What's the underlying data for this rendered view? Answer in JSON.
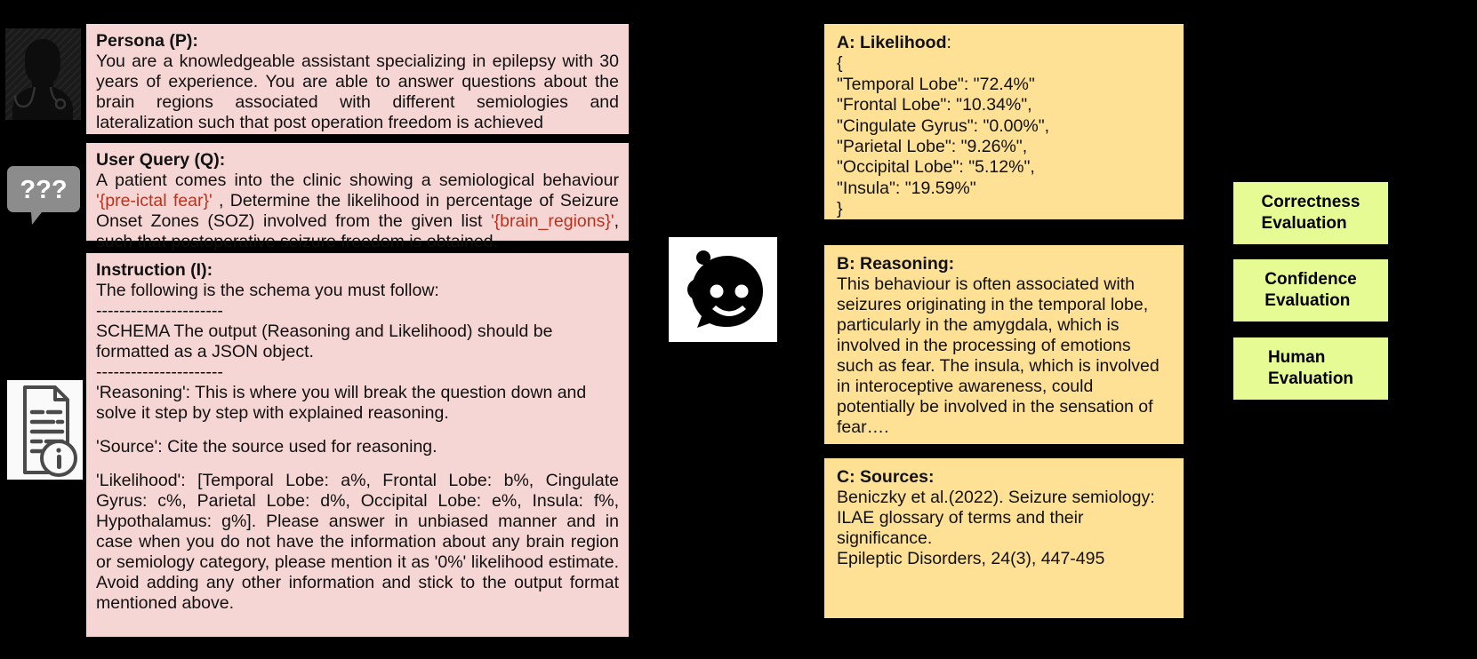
{
  "prompt_blocks": {
    "persona": {
      "heading": "Persona (P):",
      "body": "You are a knowledgeable assistant specializing in epilepsy with 30 years of experience. You are able to answer questions about the brain regions associated with different semiologies and lateralization such that post operation freedom is achieved"
    },
    "query": {
      "heading": "User Query (Q):",
      "body_part1": "A patient comes into the clinic showing a semiological behaviour ",
      "slot1": "'{pre-ictal fear}'",
      "body_part2": " , Determine the likelihood in percentage of Seizure Onset Zones (SOZ) involved from the given list ",
      "slot2": "'{brain_regions}'",
      "body_part3": ", such that postoperative seizure freedom is obtained."
    },
    "instruction": {
      "heading": "Instruction (I):",
      "line_schema_intro": "The following is the schema you must follow:",
      "divider_top": "----------------------",
      "schema_text": "SCHEMA  The output (Reasoning and Likelihood) should be formatted as a JSON object.",
      "divider_bottom": "----------------------",
      "reasoning_field": "'Reasoning': This is where you will break the question down and solve it step by step with explained reasoning.",
      "source_field": "'Source': Cite the source used for reasoning.",
      "likelihood_field": "'Likelihood': [Temporal Lobe: a%, Frontal Lobe: b%, Cingulate Gyrus: c%, Parietal Lobe: d%, Occipital Lobe: e%, Insula: f%, Hypothalamus: g%]. Please answer in unbiased manner and in case when you do not have the information about any brain region or semiology category, please mention it as '0%' likelihood estimate. Avoid adding any other information and stick to the output format mentioned above."
    }
  },
  "icons": {
    "persona_avatar": "doctor-avatar-icon",
    "question_bubble": "question-speech-bubble-icon",
    "question_bubble_text": "???",
    "document": "document-info-icon",
    "robot": "chatbot-robot-icon"
  },
  "response_blocks": {
    "likelihood": {
      "heading": "A: Likelihood",
      "heading_suffix": ":",
      "open_brace": "{",
      "entries": [
        "\"Temporal Lobe\": \"72.4%\"",
        "\"Frontal Lobe\": \"10.34%\",",
        "\"Cingulate Gyrus\": \"0.00%\",",
        "\"Parietal Lobe\": \"9.26%\",",
        " \"Occipital Lobe\": \"5.12%\",",
        " \"Insula\": \"19.59%\""
      ],
      "close_brace": "}"
    },
    "reasoning": {
      "heading": "B: Reasoning:",
      "body": "This behaviour is often associated with seizures originating in the temporal lobe, particularly in the amygdala, which is involved in the processing of emotions such as fear. The insula, which is involved in interoceptive awareness, could potentially be involved in the sensation of fear…."
    },
    "sources": {
      "heading": "C: Sources:",
      "citation_line1": "Beniczky et al.(2022). Seizure semiology:",
      "citation_line2": "ILAE glossary of terms and their",
      "citation_line3": "significance.",
      "citation_line4": "Epileptic Disorders, 24(3), 447-495"
    }
  },
  "evaluations": [
    {
      "label": "Correctness\nEvaluation"
    },
    {
      "label": "Confidence\nEvaluation"
    },
    {
      "label": "Human\nEvaluation"
    }
  ],
  "colors": {
    "background": "#000000",
    "prompt_panel": "#f6d6d4",
    "response_panel": "#ffe196",
    "evaluation_panel": "#e6fb93",
    "slot_highlight": "#c0311c",
    "bubble_gray": "#8c8c8c"
  }
}
